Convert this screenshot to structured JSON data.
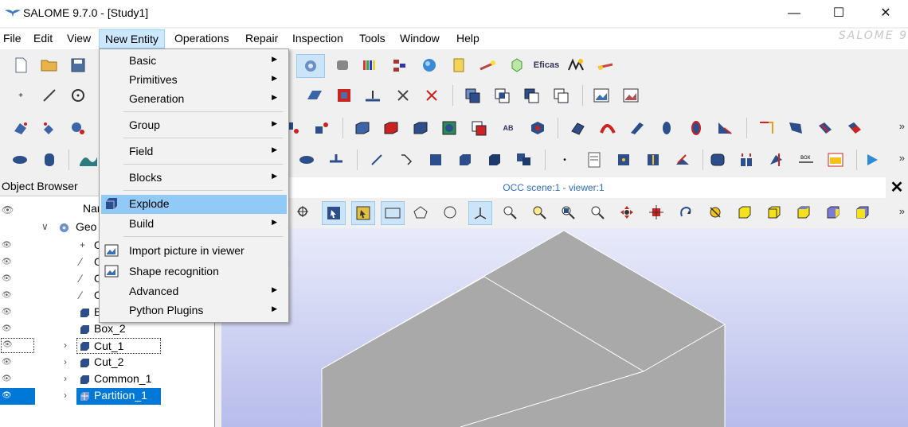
{
  "window": {
    "title": "SALOME  9.7.0 - [Study1]",
    "controls": [
      "—",
      "☐",
      "✕"
    ]
  },
  "watermark": "SALOME 9",
  "menubar": {
    "items": [
      "File",
      "Edit",
      "View",
      "New Entity",
      "Operations",
      "Repair",
      "Inspection",
      "Tools",
      "Window",
      "Help"
    ]
  },
  "dropdown": {
    "items": [
      {
        "label": "Basic",
        "submenu": true
      },
      {
        "label": "Primitives",
        "submenu": true
      },
      {
        "label": "Generation",
        "submenu": true
      },
      {
        "label": "Group",
        "submenu": true
      },
      {
        "label": "Field",
        "submenu": true
      },
      {
        "label": "Blocks",
        "submenu": true
      },
      {
        "label": "Explode",
        "submenu": false,
        "highlighted": true
      },
      {
        "label": "Build",
        "submenu": true
      },
      {
        "label": "Import picture in viewer",
        "submenu": false
      },
      {
        "label": "Shape recognition",
        "submenu": false
      },
      {
        "label": "Advanced",
        "submenu": true
      },
      {
        "label": "Python Plugins",
        "submenu": true
      }
    ],
    "arrow": "▶"
  },
  "toolbar": {
    "overflow": "»",
    "efficas_label": "Eficas"
  },
  "object_browser": {
    "header": "Object Browser",
    "column_name": "Nar",
    "root_label": "Geo",
    "rows": [
      {
        "label": "O",
        "icon": "vertex"
      },
      {
        "label": "O",
        "icon": "vector"
      },
      {
        "label": "O",
        "icon": "vector"
      },
      {
        "label": "O",
        "icon": "vector"
      },
      {
        "label": "B",
        "icon": "box"
      },
      {
        "label": "Box_2",
        "icon": "box"
      },
      {
        "label": "Cut_1",
        "icon": "box"
      },
      {
        "label": "Cut_2",
        "icon": "box"
      },
      {
        "label": "Common_1",
        "icon": "box"
      },
      {
        "label": "Partition_1",
        "icon": "partition"
      }
    ]
  },
  "viewer": {
    "title": "OCC scene:1 - viewer:1",
    "close": "✕"
  },
  "colors": {
    "accent": "#2e6ec2",
    "selection": "#0078d7",
    "menu_highlight": "#91c9f7",
    "scene_top": "#e9ebfa",
    "scene_bottom": "#b7bceb",
    "shape": "#a9a9a9"
  }
}
